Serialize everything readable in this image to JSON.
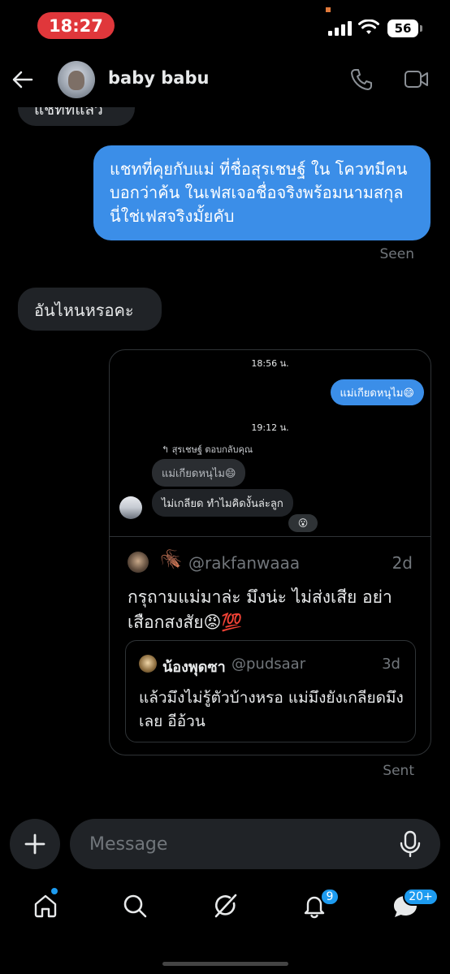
{
  "status_bar": {
    "time": "18:27",
    "battery": "56"
  },
  "header": {
    "contact_name": "baby babu"
  },
  "messages": {
    "cut_text": "แชทที่แล้ว",
    "outgoing_1": "แชทที่คุยกับแม่ ที่ชื่อสุรเชษฐ์ ใน โควทมีคนบอกว่าค้น ในเฟสเจอชื่อจริงพร้อมนามสกุล นี่ใช่เฟสจริงมั้ยคับ",
    "seen": "Seen",
    "incoming_1": "อันไหนหรอคะ",
    "sent": "Sent"
  },
  "shared_card": {
    "timestamp_1": "18:56 น.",
    "outgoing_mini": "แม่เกียดหนุไม😄",
    "timestamp_2": "19:12 น.",
    "reply_label": "สุรเชษฐ์ ตอบกลับคุณ",
    "quoted_reply": "แม่เกียดหนุไม😄",
    "incoming_mini": "ไม่เกลียด ทำไมคิดงั้นล่ะลูก",
    "reaction": "😮",
    "post": {
      "handle": "@rakfanwaaa",
      "time": "2d",
      "text": "กรุถามแม่มาล่ะ มึงน่ะ ไม่ส่งเสีย อย่าเสือกสงสัย😡💯",
      "quote": {
        "name": "น้องพุดซา",
        "handle": "@pudsaar",
        "time": "3d",
        "text": "แล้วมึงไม่รู้ตัวบ้างหรอ แม่มึงยังเกลียดมึงเลย อีอ้วน"
      }
    }
  },
  "composer": {
    "placeholder": "Message"
  },
  "nav": {
    "notif_badge": "9",
    "msgs_badge": "20+"
  },
  "colors": {
    "accent": "#1d9bf0",
    "outgoing_bubble": "#3b8ee8",
    "incoming_bubble": "#202327",
    "muted_text": "#71767b"
  }
}
